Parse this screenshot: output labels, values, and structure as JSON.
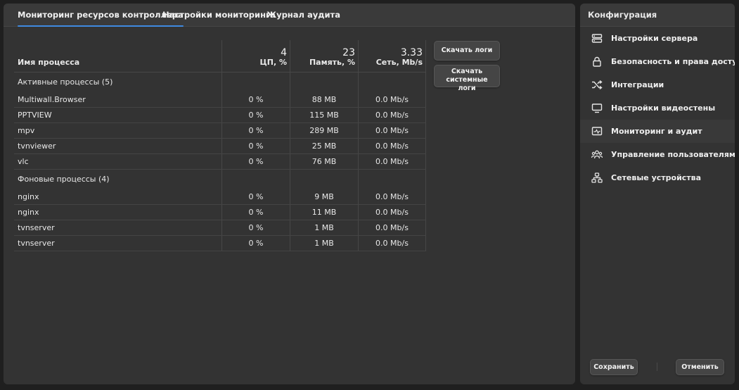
{
  "tabs": [
    {
      "label": "Мониторинг ресурсов контроллера",
      "active": true
    },
    {
      "label": "Настройки мониторинга"
    },
    {
      "label": "Журнал аудита"
    }
  ],
  "table": {
    "name_header": "Имя процесса",
    "cpu": {
      "total": "4",
      "label": "ЦП, %"
    },
    "mem": {
      "total": "23",
      "label": "Память, %"
    },
    "net": {
      "total": "3.33",
      "label": "Сеть, Mb/s"
    },
    "active_group": "Активные процессы (5)",
    "active": [
      {
        "name": "Multiwall.Browser",
        "cpu": "0 %",
        "mem": "88 MB",
        "net": "0.0 Mb/s"
      },
      {
        "name": "PPTVIEW",
        "cpu": "0 %",
        "mem": "115 MB",
        "net": "0.0 Mb/s"
      },
      {
        "name": "mpv",
        "cpu": "0 %",
        "mem": "289 MB",
        "net": "0.0 Mb/s"
      },
      {
        "name": "tvnviewer",
        "cpu": "0 %",
        "mem": "25 MB",
        "net": "0.0 Mb/s"
      },
      {
        "name": "vlc",
        "cpu": "0 %",
        "mem": "76 MB",
        "net": "0.0 Mb/s"
      }
    ],
    "background_group": "Фоновые процессы (4)",
    "background": [
      {
        "name": "nginx",
        "cpu": "0 %",
        "mem": "9 MB",
        "net": "0.0 Mb/s"
      },
      {
        "name": "nginx",
        "cpu": "0 %",
        "mem": "11 MB",
        "net": "0.0 Mb/s"
      },
      {
        "name": "tvnserver",
        "cpu": "0 %",
        "mem": "1 MB",
        "net": "0.0 Mb/s"
      },
      {
        "name": "tvnserver",
        "cpu": "0 %",
        "mem": "1 MB",
        "net": "0.0 Mb/s"
      }
    ]
  },
  "actions": {
    "download_logs": "Скачать логи",
    "download_system_logs_line1": "Скачать системные",
    "download_system_logs_line2": "логи"
  },
  "sidebar": {
    "title": "Конфигурация",
    "items": [
      {
        "label": "Настройки сервера",
        "icon": "server-icon"
      },
      {
        "label": "Безопасность и права доступа",
        "icon": "lock-icon"
      },
      {
        "label": "Интеграции",
        "icon": "shuffle-icon"
      },
      {
        "label": "Настройки видеостены",
        "icon": "monitor-icon"
      },
      {
        "label": "Мониторинг и аудит",
        "icon": "monitoring-icon",
        "active": true
      },
      {
        "label": "Управление пользователями",
        "icon": "users-icon"
      },
      {
        "label": "Сетевые устройства",
        "icon": "network-icon"
      }
    ],
    "save_label": "Сохранить",
    "cancel_label": "Отменить"
  },
  "colors": {
    "accent": "#3f8ae0",
    "panel": "#333333",
    "background": "#1f1f1f"
  }
}
